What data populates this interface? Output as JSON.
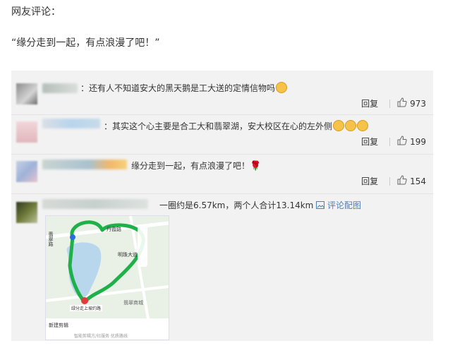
{
  "intro": {
    "title": "网友评论：",
    "quote": "“缘分走到一起，有点浪漫了吧！”"
  },
  "comments": [
    {
      "text": "：还有人不知道安大的黑天鹅是工大送的定情信物吗",
      "reply_label": "回复",
      "likes": "973"
    },
    {
      "text": "：其实这个心主要是合工大和翡翠湖，安大校区在心的左外侧",
      "reply_label": "回复",
      "likes": "199"
    },
    {
      "text": "缘分走到一起，有点浪漫了吧！",
      "reply_label": "回复",
      "likes": "154"
    },
    {
      "text": "一圈约是6.57km，两个人合计13.14km",
      "image_link": "评论配图"
    }
  ],
  "map": {
    "labels": {
      "road_a": "翡翠路",
      "road_b": "丹霞路",
      "road_c": "明珠大道",
      "road_d": "翡翠路",
      "area": "翡翠商城",
      "route_info": "绿分走上坡约路",
      "bottom_left": "新建剪辑",
      "bottom_text": "智能剪辑方/社服务 优质路线"
    },
    "colors": {
      "route": "#1fb04a",
      "lake": "#b9d7ec",
      "land": "#e9f0e6"
    }
  },
  "colors": {
    "link": "#4a7fc1",
    "rose": "#d0142c",
    "emoji": "#f6c34a"
  }
}
